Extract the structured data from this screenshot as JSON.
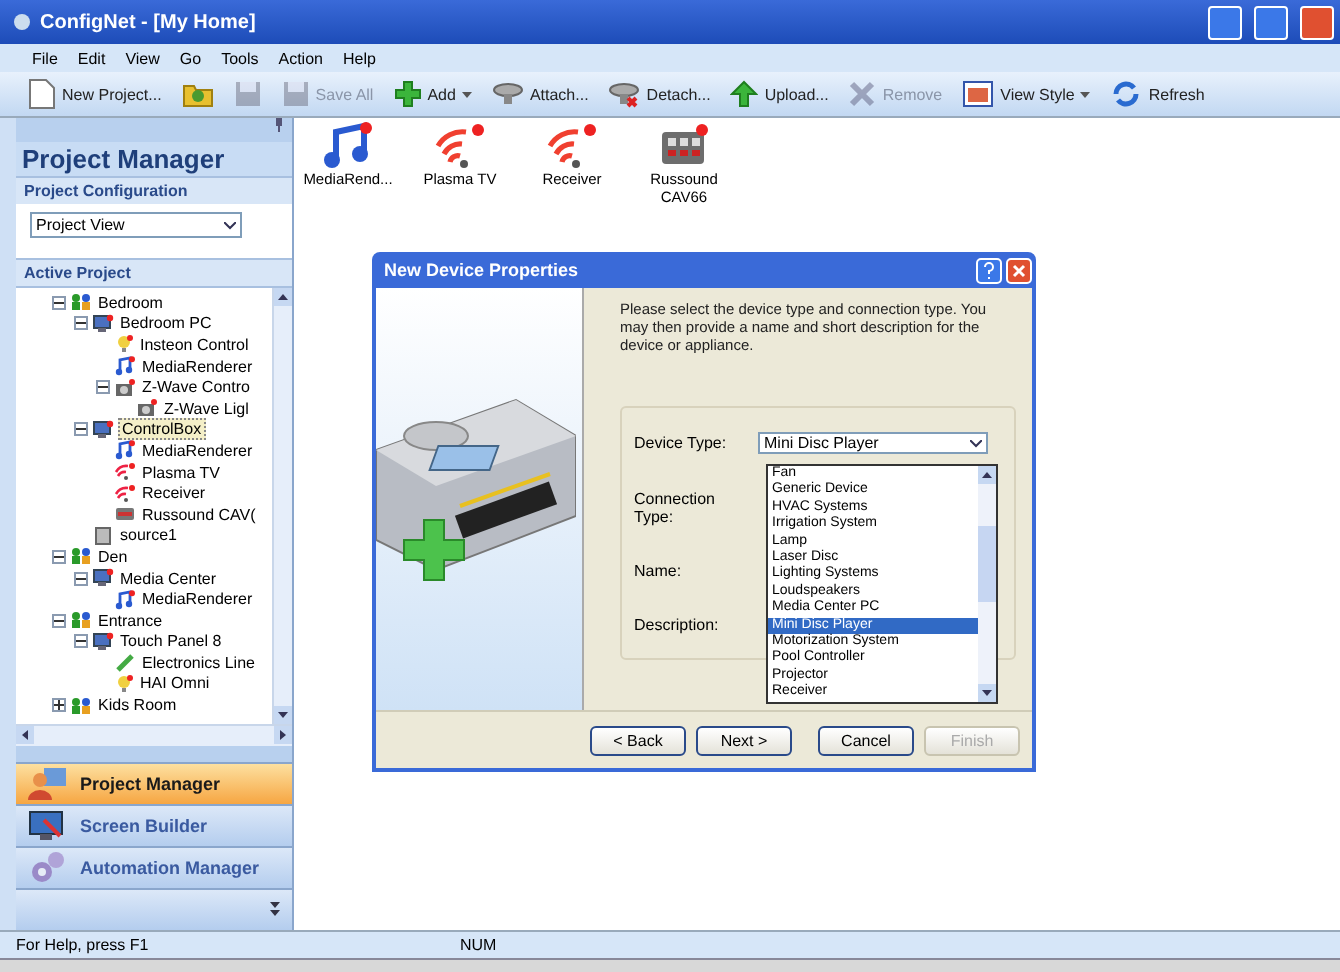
{
  "window": {
    "title": "ConfigNet - [My Home]"
  },
  "menu": [
    "File",
    "Edit",
    "View",
    "Go",
    "Tools",
    "Action",
    "Help"
  ],
  "toolbar": [
    {
      "kind": "new",
      "label": "New Project...",
      "disabled": false
    },
    {
      "kind": "folder",
      "disabled": false
    },
    {
      "kind": "save",
      "disabled": true
    },
    {
      "kind": "saveall",
      "label": "Save All",
      "disabled": true
    },
    {
      "kind": "add",
      "label": "Add",
      "dropdown": true,
      "disabled": false
    },
    {
      "kind": "attach",
      "label": "Attach...",
      "disabled": false
    },
    {
      "kind": "detach",
      "label": "Detach...",
      "disabled": false
    },
    {
      "kind": "upload",
      "label": "Upload...",
      "disabled": false
    },
    {
      "kind": "remove",
      "label": "Remove",
      "disabled": true
    },
    {
      "kind": "view",
      "label": "View Style",
      "dropdown": true,
      "disabled": false
    },
    {
      "kind": "refresh",
      "label": "Refresh",
      "disabled": false
    }
  ],
  "sidebar": {
    "title": "Project Manager",
    "config_header": "Project Configuration",
    "config_value": "Project View",
    "active_header": "Active Project",
    "tree": [
      {
        "label": "Bedroom",
        "kind": "room",
        "expanded": true,
        "selected": false,
        "children": [
          {
            "label": "Bedroom PC",
            "kind": "pc",
            "expanded": true,
            "selected": false,
            "children": [
              {
                "label": "Insteon Control",
                "kind": "bulb",
                "selected": false
              },
              {
                "label": "MediaRenderer",
                "kind": "music",
                "selected": false
              },
              {
                "label": "Z-Wave Contro",
                "kind": "camera",
                "expanded": true,
                "selected": false,
                "children": [
                  {
                    "label": "Z-Wave Ligl",
                    "kind": "camera",
                    "selected": false
                  }
                ]
              }
            ]
          },
          {
            "label": "ControlBox",
            "kind": "pc",
            "expanded": true,
            "selected": true,
            "children": [
              {
                "label": "MediaRenderer",
                "kind": "music",
                "selected": false
              },
              {
                "label": "Plasma TV",
                "kind": "wireless",
                "selected": false
              },
              {
                "label": "Receiver",
                "kind": "wireless",
                "selected": false
              },
              {
                "label": "Russound CAV(",
                "kind": "rack",
                "selected": false
              }
            ]
          },
          {
            "label": "source1",
            "kind": "source",
            "selected": false
          }
        ]
      },
      {
        "label": "Den",
        "kind": "room",
        "expanded": true,
        "selected": false,
        "children": [
          {
            "label": "Media Center",
            "kind": "pc",
            "expanded": true,
            "selected": false,
            "children": [
              {
                "label": "MediaRenderer",
                "kind": "music",
                "selected": false
              }
            ]
          }
        ]
      },
      {
        "label": "Entrance",
        "kind": "room",
        "expanded": true,
        "selected": false,
        "children": [
          {
            "label": "Touch Panel 8",
            "kind": "panel",
            "expanded": true,
            "selected": false,
            "children": [
              {
                "label": "Electronics Line",
                "kind": "pen",
                "selected": false
              },
              {
                "label": "HAI Omni",
                "kind": "bulb",
                "selected": false
              }
            ]
          }
        ]
      },
      {
        "label": "Kids Room",
        "kind": "room",
        "expanded": false,
        "selected": false
      }
    ],
    "nav": [
      {
        "label": "Project Manager",
        "kind": "project",
        "selected": true
      },
      {
        "label": "Screen Builder",
        "kind": "screen",
        "selected": false
      },
      {
        "label": "Automation Manager",
        "kind": "gears",
        "selected": false
      }
    ]
  },
  "devices": [
    {
      "label": "MediaRend...",
      "kind": "music"
    },
    {
      "label": "Plasma TV",
      "kind": "wireless"
    },
    {
      "label": "Receiver",
      "kind": "wireless"
    },
    {
      "label": "Russound CAV66",
      "kind": "rack"
    }
  ],
  "dialog": {
    "title": "New Device Properties",
    "intro": "Please select the device type and connection type. You may then provide a name and short description for the device or appliance.",
    "fields": [
      "Device Type:",
      "Connection Type:",
      "Name:",
      "Description:"
    ],
    "device_type": "Mini Disc Player",
    "options": [
      {
        "label": "Fan",
        "selected": false
      },
      {
        "label": "Generic Device",
        "selected": false
      },
      {
        "label": "HVAC Systems",
        "selected": false
      },
      {
        "label": "Irrigation System",
        "selected": false
      },
      {
        "label": "Lamp",
        "selected": false
      },
      {
        "label": "Laser Disc",
        "selected": false
      },
      {
        "label": "Lighting Systems",
        "selected": false
      },
      {
        "label": "Loudspeakers",
        "selected": false
      },
      {
        "label": "Media Center PC",
        "selected": false
      },
      {
        "label": "Mini Disc Player",
        "selected": true
      },
      {
        "label": "Motorization System",
        "selected": false
      },
      {
        "label": "Pool Controller",
        "selected": false
      },
      {
        "label": "Projector",
        "selected": false
      },
      {
        "label": "Receiver",
        "selected": false
      }
    ],
    "buttons": [
      {
        "label": "< Back",
        "disabled": false
      },
      {
        "label": "Next >",
        "disabled": false
      },
      {
        "label": "Cancel",
        "disabled": false
      },
      {
        "label": "Finish",
        "disabled": true
      }
    ]
  },
  "status_bar": {
    "text": "For Help, press F1",
    "indicator": "NUM"
  }
}
